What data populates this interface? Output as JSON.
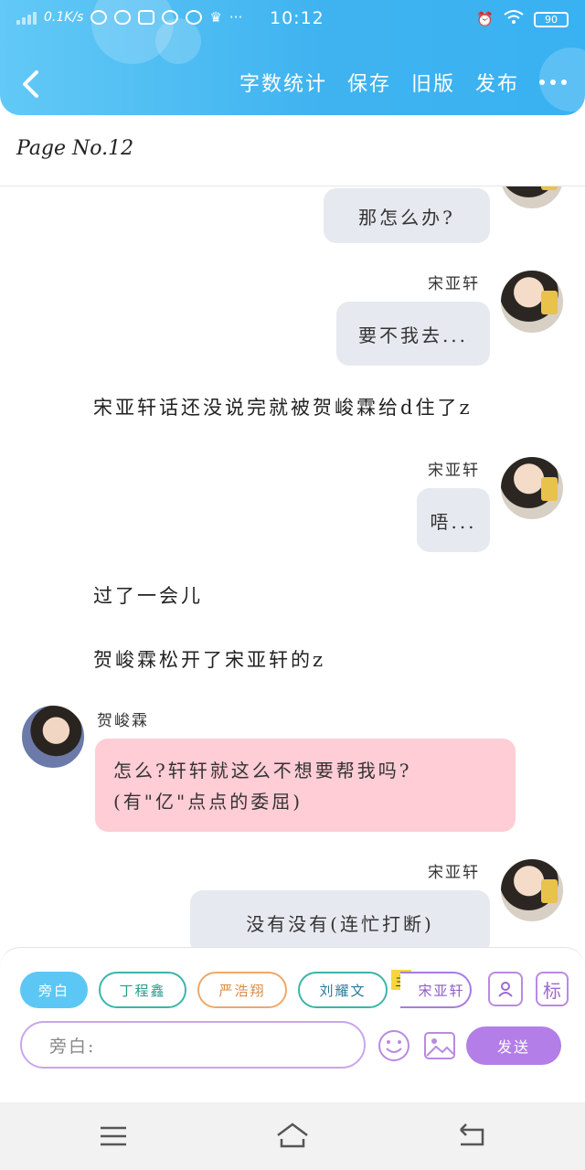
{
  "status_bar": {
    "net_speed": "0.1K/s",
    "time": "10:12",
    "battery": "90"
  },
  "header": {
    "actions": [
      "字数统计",
      "保存",
      "旧版",
      "发布"
    ]
  },
  "page": {
    "page_no": "Page No.12"
  },
  "messages": {
    "m1_text": "那怎么办?",
    "m2_name": "宋亚轩",
    "m2_text": "要不我去...",
    "narr1": "宋亚轩话还没说完就被贺峻霖给d住了z",
    "m3_name": "宋亚轩",
    "m3_text": "唔...",
    "narr2": "过了一会儿",
    "narr3": "贺峻霖松开了宋亚轩的z",
    "m4_name": "贺峻霖",
    "m4_text": "怎么?轩轩就这么不想要帮我吗?(有\"亿\"点点的委屈)",
    "m5_name": "宋亚轩",
    "m5_text": "没有没有(连忙打断)"
  },
  "panel": {
    "chips": [
      "旁白",
      "丁程鑫",
      "严浩翔",
      "刘耀文",
      "宋亚轩"
    ],
    "main_tag": "主",
    "tag_icon": "标",
    "input_placeholder": "旁白:",
    "send_label": "发送"
  },
  "icons": {
    "back": "chevron-left-icon",
    "more": "more-icon",
    "contact": "contact-card-icon",
    "emoji": "emoji-icon",
    "image": "image-icon"
  },
  "colors": {
    "header_blue": "#3fb3f0",
    "bubble_gray": "#e6e9ef",
    "bubble_pink": "#ffcdd6",
    "accent_purple": "#b37ee8"
  }
}
